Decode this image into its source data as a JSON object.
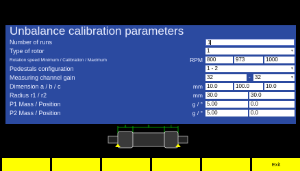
{
  "panel": {
    "title": "Unbalance calibration parameters",
    "rows": [
      {
        "label": "Number of runs",
        "unit": "",
        "values": [
          "1"
        ]
      },
      {
        "label": "Type of rotor",
        "unit": "",
        "values": [
          "1"
        ]
      },
      {
        "label": "Rotation speed Minimum / Calibration / Maximum",
        "unit": "RPM",
        "values": [
          "800",
          "973",
          "1000"
        ]
      },
      {
        "label": "Pedestals configuration",
        "unit": "",
        "values": [
          "1 - 2"
        ]
      },
      {
        "label": "Measuring channel gain",
        "unit": "",
        "values": [
          "32",
          "32"
        ],
        "separator": "-"
      },
      {
        "label": "Dimension a / b / c",
        "unit": "mm",
        "values": [
          "10.0",
          "100.0",
          "10.0"
        ]
      },
      {
        "label": "Radius r1 / r2",
        "unit": "mm",
        "values": [
          "30.0",
          "30.0"
        ]
      },
      {
        "label": "P1 Mass / Position",
        "unit": "g / °",
        "values": [
          "5.00",
          "0.0"
        ]
      },
      {
        "label": "P2 Mass / Position",
        "unit": "g / °",
        "values": [
          "5.00",
          "0.0"
        ]
      }
    ]
  },
  "drawing": {
    "dim_a": "a",
    "dim_b": "b",
    "dim_c": "c",
    "color_lines": "#00cc00",
    "color_supports": "#ffff00"
  },
  "function_keys": [
    "",
    "",
    "",
    "",
    "",
    "Exit"
  ],
  "colors": {
    "panel": "#2b4aa0",
    "fkey": "#ffff00",
    "text": "#e8ecff"
  }
}
